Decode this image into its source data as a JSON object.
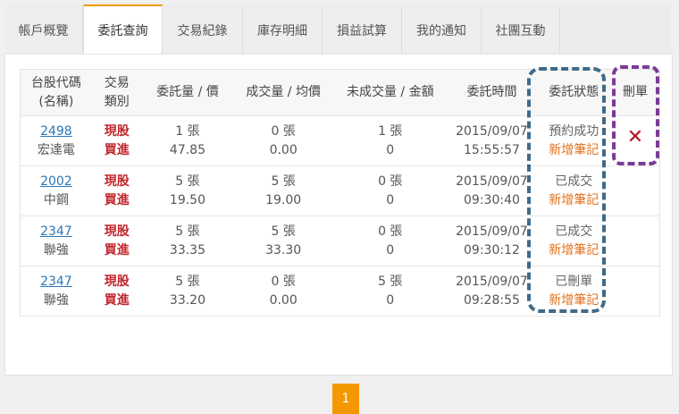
{
  "tabs": [
    {
      "label": "帳戶概覽"
    },
    {
      "label": "委託查詢"
    },
    {
      "label": "交易紀錄"
    },
    {
      "label": "庫存明細"
    },
    {
      "label": "損益試算"
    },
    {
      "label": "我的通知"
    },
    {
      "label": "社團互動"
    }
  ],
  "table": {
    "headers": {
      "code_line1": "台股代碼",
      "code_line2": "(名稱)",
      "type_line1": "交易",
      "type_line2": "類別",
      "order_qty": "委託量 / 價",
      "filled": "成交量 / 均價",
      "unfilled": "未成交量 / 金額",
      "time": "委託時間",
      "status": "委託狀態",
      "delete": "刪單"
    },
    "rows": [
      {
        "code": "2498",
        "name": "宏達電",
        "kind": "現股",
        "side": "買進",
        "qty": "1 張",
        "price": "47.85",
        "fqty": "0 張",
        "favg": "0.00",
        "uqty": "1 張",
        "uamt": "0",
        "date": "2015/09/07",
        "time": "15:55:57",
        "status": "預約成功",
        "note": "新增筆記"
      },
      {
        "code": "2002",
        "name": "中鋼",
        "kind": "現股",
        "side": "買進",
        "qty": "5 張",
        "price": "19.50",
        "fqty": "5 張",
        "favg": "19.00",
        "uqty": "0 張",
        "uamt": "0",
        "date": "2015/09/07",
        "time": "09:30:40",
        "status": "已成交",
        "note": "新增筆記"
      },
      {
        "code": "2347",
        "name": "聯強",
        "kind": "現股",
        "side": "買進",
        "qty": "5 張",
        "price": "33.35",
        "fqty": "5 張",
        "favg": "33.30",
        "uqty": "0 張",
        "uamt": "0",
        "date": "2015/09/07",
        "time": "09:30:12",
        "status": "已成交",
        "note": "新增筆記"
      },
      {
        "code": "2347",
        "name": "聯強",
        "kind": "現股",
        "side": "買進",
        "qty": "5 張",
        "price": "33.20",
        "fqty": "0 張",
        "favg": "0.00",
        "uqty": "5 張",
        "uamt": "0",
        "date": "2015/09/07",
        "time": "09:28:55",
        "status": "已刪單",
        "note": "新增筆記"
      }
    ]
  },
  "delete_icon": "close-x-icon",
  "pagination": {
    "current": "1"
  },
  "colors": {
    "accent": "#f39800",
    "buy_red": "#c1272d",
    "note_orange": "#e0731f",
    "highlight_blue": "#3f6a8a",
    "highlight_purple": "#7a3b98"
  }
}
